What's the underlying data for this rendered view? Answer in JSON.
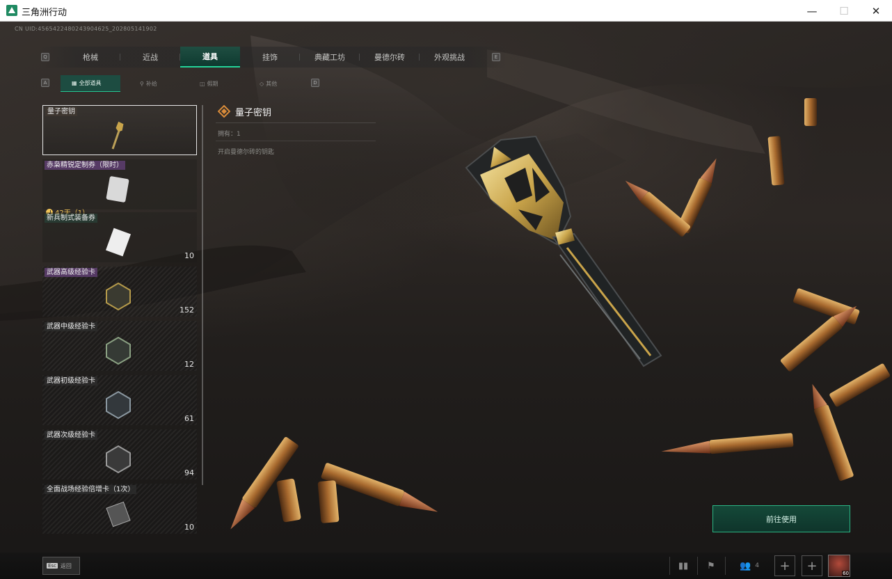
{
  "window": {
    "title": "三角洲行动"
  },
  "uid": "CN UID:4565422480243904625_202805141902",
  "tabs": {
    "prev_key": "Q",
    "next_key": "E",
    "items": [
      {
        "label": "枪械"
      },
      {
        "label": "近战"
      },
      {
        "label": "道具",
        "active": true
      },
      {
        "label": "挂饰"
      },
      {
        "label": "典藏工坊"
      },
      {
        "label": "曼德尔砖"
      },
      {
        "label": "外观挑战"
      }
    ]
  },
  "subtabs": {
    "prev_key": "A",
    "next_key": "D",
    "items": [
      {
        "label": "全部道具",
        "icon": "grid-icon",
        "active": true
      },
      {
        "label": "补给",
        "icon": "supply-icon"
      },
      {
        "label": "假期",
        "icon": "gift-icon"
      },
      {
        "label": "其他",
        "icon": "diamond-icon"
      }
    ]
  },
  "items": [
    {
      "name": "量子密钥",
      "count": "",
      "style": "plain",
      "icon": "quantum-key-icon",
      "selected": true
    },
    {
      "name": "赤枭精锐定制券（限时）",
      "count": "",
      "style": "purple",
      "icon": "voucher-icon",
      "timer": "42天（1）"
    },
    {
      "name": "新兵制式装备券",
      "count": "10",
      "style": "green",
      "icon": "paper-voucher-icon"
    },
    {
      "name": "武器高级经验卡",
      "count": "152",
      "style": "purple",
      "icon": "exp-card-gold-icon"
    },
    {
      "name": "武器中级经验卡",
      "count": "12",
      "style": "dark",
      "icon": "exp-card-green-icon"
    },
    {
      "name": "武器初级经验卡",
      "count": "61",
      "style": "dark",
      "icon": "exp-card-blue-icon"
    },
    {
      "name": "武器次级经验卡",
      "count": "94",
      "style": "dark",
      "icon": "exp-card-gray-icon"
    },
    {
      "name": "全面战场经验倍增卡（1次）",
      "count": "10",
      "style": "dark",
      "icon": "exp-boost-card-icon"
    }
  ],
  "detail": {
    "title": "量子密钥",
    "owned": "拥有：1",
    "description": "开启曼德尔砖的钥匙"
  },
  "actions": {
    "use_label": "前往使用"
  },
  "bottom": {
    "esc_key": "Esc",
    "esc_label": "返回",
    "friends_count": "4",
    "avatar_level": "60"
  },
  "colors": {
    "accent": "#24d59a",
    "selected_tab": "#1d4c41",
    "timer": "#f0c458"
  }
}
